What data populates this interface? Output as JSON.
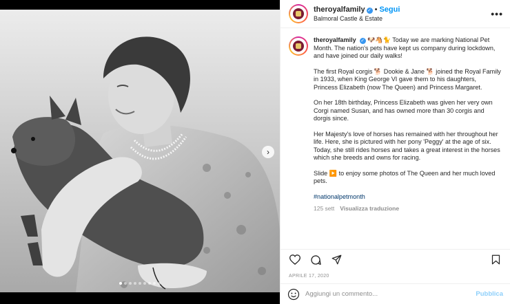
{
  "header": {
    "username": "theroyalfamily",
    "verified_mark": "✓",
    "separator": "•",
    "follow_label": "Segui",
    "location": "Balmoral Castle & Estate",
    "more_label": "•••"
  },
  "caption": {
    "username": "theroyalfamily",
    "emojis": "🐶🐴🐈",
    "p1": "Today we are marking National Pet Month. The nation's pets have kept us company during lockdown, and have joined our daily walks!",
    "p2": "The first Royal corgis 🐕 Dookie & Jane 🐕 joined the Royal Family in 1933, when King George VI gave them to his daughters, Princess Elizabeth (now The Queen) and Princess Margaret.",
    "p3": "On her 18th birthday, Princess Elizabeth was given her very own Corgi named Susan, and has owned more than 30 corgis and dorgis since.",
    "p4": "Her Majesty's love of horses has remained with her throughout her life. Here, she is pictured with her pony 'Peggy' at the age of six. Today, she still rides horses and takes a great interest in the horses which she breeds and owns for racing.",
    "p5": "Slide ▶️ to enjoy some photos of The Queen and her much loved pets.",
    "hashtag": "#nationalpetmonth",
    "time_ago": "125 sett",
    "translate_label": "Visualizza traduzione"
  },
  "icons": {
    "like": "heart-icon",
    "comment": "comment-icon",
    "share": "share-icon",
    "save": "bookmark-icon",
    "emoji": "smile-icon",
    "next": "chevron-right-icon"
  },
  "date": "APRILE 17, 2020",
  "comment": {
    "placeholder": "Aggiungi un commento...",
    "publish_label": "Pubblica"
  },
  "media": {
    "next_arrow": "›",
    "dots_total": 9,
    "dots_active": 0
  },
  "colors": {
    "accent": "#0095f6",
    "verified": "#3897f0",
    "hashtag": "#00376b",
    "meta": "#8e8e8e"
  }
}
